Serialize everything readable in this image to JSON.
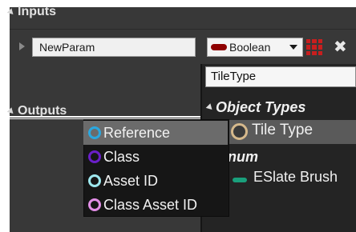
{
  "inputs": {
    "header": "Inputs",
    "param": {
      "name_value": "NewParam",
      "type_label": "Boolean",
      "type_color": "#8e0000",
      "grid_icon_color": "#c81e1e",
      "close_glyph": "✖"
    }
  },
  "outputs": {
    "header": "Outputs"
  },
  "type_picker": {
    "search_value": "TileType",
    "categories": {
      "object_types": "Object Types",
      "enum": "num"
    },
    "items": {
      "tile_type": {
        "label": "Tile Type",
        "ring_color": "#d6b98c"
      },
      "eslate_brush": {
        "label": "ESlate Brush",
        "pill_color": "#1aa07c"
      }
    }
  },
  "pin_type_menu": {
    "items": [
      {
        "label": "Reference",
        "ring_color": "#2aa8e0",
        "selected": true
      },
      {
        "label": "Class",
        "ring_color": "#6a1fc8",
        "selected": false
      },
      {
        "label": "Asset ID",
        "ring_color": "#9ee8ee",
        "selected": false
      },
      {
        "label": "Class Asset ID",
        "ring_color": "#e28ee6",
        "selected": false
      }
    ]
  }
}
